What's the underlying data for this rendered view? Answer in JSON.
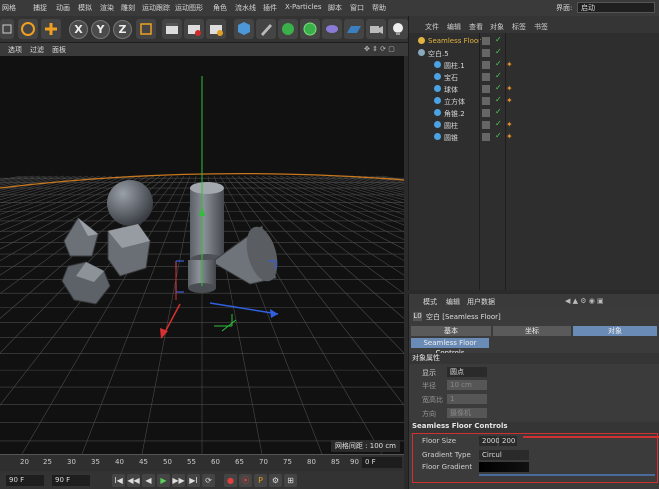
{
  "menubar": {
    "items": [
      "网格",
      "捕捉",
      "动画",
      "模拟",
      "渲染",
      "雕刻",
      "运动跟踪",
      "运动图形",
      "角色",
      "流水线",
      "插件",
      "X-Particles",
      "脚本",
      "窗口",
      "帮助"
    ],
    "layout_label": "界面:",
    "layout_value": "启动"
  },
  "toolbar": {
    "x_label": "X",
    "y_label": "Y",
    "z_label": "Z"
  },
  "viewport": {
    "menu": [
      "选项",
      "过滤",
      "面板"
    ],
    "grid_status": "网格间距 : 100 cm"
  },
  "timeline": {
    "ticks": [
      "20",
      "25",
      "30",
      "35",
      "40",
      "45",
      "50",
      "55",
      "60",
      "65",
      "70",
      "75",
      "80",
      "85",
      "90"
    ],
    "frame": "0 F"
  },
  "transport": {
    "start_field": "90 F",
    "end_field": "90 F",
    "buttons": [
      "I◀",
      "◀◀",
      "◀",
      "▶",
      "▶▶",
      "▶I",
      "⟳",
      "●",
      "⦿",
      "P",
      "⚙",
      "⊞"
    ]
  },
  "object_manager": {
    "tabs": [
      "文件",
      "编辑",
      "查看",
      "对象",
      "标签",
      "书签"
    ],
    "rows": [
      {
        "name": "Seamless Floor",
        "indent": 0,
        "color": "#e3b340",
        "highlight": true,
        "tag": ""
      },
      {
        "name": "空白.5",
        "indent": 0,
        "color": "#8ab",
        "highlight": false,
        "tag": ""
      },
      {
        "name": "圆柱.1",
        "indent": 2,
        "color": "#4ba3e6",
        "highlight": false,
        "tag": "✦"
      },
      {
        "name": "宝石",
        "indent": 2,
        "color": "#4ba3e6",
        "highlight": false,
        "tag": ""
      },
      {
        "name": "球体",
        "indent": 2,
        "color": "#4ba3e6",
        "highlight": false,
        "tag": "✦"
      },
      {
        "name": "立方体",
        "indent": 2,
        "color": "#4ba3e6",
        "highlight": false,
        "tag": "✦"
      },
      {
        "name": "角锥.2",
        "indent": 2,
        "color": "#4ba3e6",
        "highlight": false,
        "tag": ""
      },
      {
        "name": "圆柱",
        "indent": 2,
        "color": "#4ba3e6",
        "highlight": false,
        "tag": "✦"
      },
      {
        "name": "圆锥",
        "indent": 2,
        "color": "#4ba3e6",
        "highlight": false,
        "tag": "✦"
      }
    ]
  },
  "attributes": {
    "menu": [
      "模式",
      "编辑",
      "用户数据"
    ],
    "object_title": "空白 [Seamless Floor]",
    "tabs": [
      "基本",
      "坐标",
      "对象"
    ],
    "active_tab": "对象",
    "controls_tab": "Seamless Floor Controls",
    "object_props_title": "对象属性",
    "display_label": "显示",
    "display_value": "圆点",
    "radius_label": "半径",
    "radius_value": "10 cm",
    "aspect_label": "宽高比",
    "aspect_value": "1",
    "orientation_label": "方向",
    "orientation_value": "摄像机",
    "controls_title": "Seamless Floor Controls",
    "floor_size_label": "Floor Size",
    "floor_size_x": "2000",
    "floor_size_y": "200",
    "gradient_type_label": "Gradient Type",
    "gradient_type_value": "Circul",
    "floor_gradient_label": "Floor Gradient"
  },
  "colors": {
    "accent_blue": "#5b9bd5",
    "selected_tab": "#6a8bb5",
    "highlight_yellow": "#e3b340",
    "check_green": "#52c85a",
    "tag_orange": "#e28b2b",
    "annotation_red": "#d03030"
  }
}
